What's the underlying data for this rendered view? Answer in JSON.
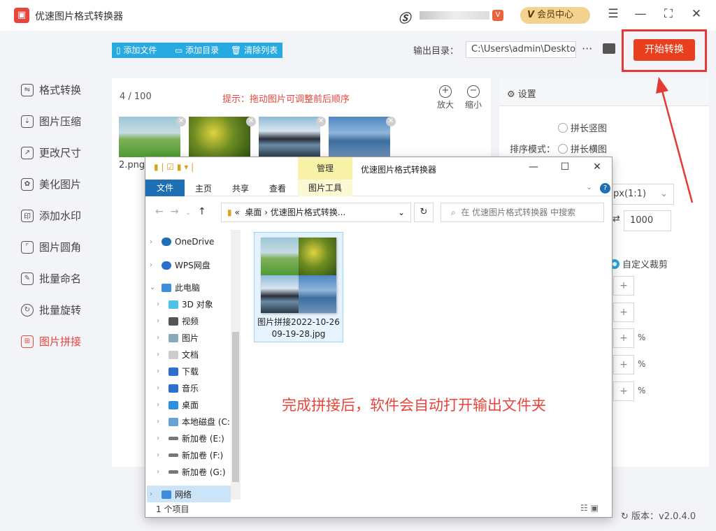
{
  "app": {
    "title": "优速图片格式转换器",
    "vip_label": "会员中心",
    "vip_glyph": "V"
  },
  "sidebar": {
    "items": [
      {
        "label": "格式转换",
        "icon": "format-convert-icon"
      },
      {
        "label": "图片压缩",
        "icon": "compress-icon"
      },
      {
        "label": "更改尺寸",
        "icon": "resize-icon"
      },
      {
        "label": "美化图片",
        "icon": "beautify-icon"
      },
      {
        "label": "添加水印",
        "icon": "watermark-icon"
      },
      {
        "label": "图片圆角",
        "icon": "round-corner-icon"
      },
      {
        "label": "批量命名",
        "icon": "rename-icon"
      },
      {
        "label": "批量旋转",
        "icon": "rotate-icon"
      },
      {
        "label": "图片拼接",
        "icon": "stitch-icon",
        "active": true
      }
    ]
  },
  "toolbar": {
    "add_file": "添加文件",
    "add_dir": "添加目录",
    "clear_list": "清除列表",
    "output_label": "输出目录：",
    "output_path": "C:\\Users\\admin\\Deskto",
    "start": "开始转换"
  },
  "panel": {
    "count": "4 / 100",
    "hint": "提示：拖动图片可调整前后顺序",
    "zoom_in": "放大",
    "zoom_out": "缩小",
    "file_label": "2.png"
  },
  "settings": {
    "title": "设置",
    "sort_label": "排序模式：",
    "vertical": "拼长竖图",
    "horizontal": "拼长横图",
    "ratio": "px(1:1)",
    "width": "1000",
    "crop": "自定义裁剪",
    "pct": "%"
  },
  "explorer": {
    "manage": "管理",
    "title": "优速图片格式转换器",
    "tabs": {
      "file": "文件",
      "home": "主页",
      "share": "共享",
      "view": "查看",
      "pictools": "图片工具"
    },
    "breadcrumb": {
      "root": "«",
      "desktop": "桌面",
      "folder": "优速图片格式转换..."
    },
    "search_placeholder": "在 优速图片格式转换器 中搜索",
    "nav": [
      "OneDrive",
      "WPS网盘",
      "此电脑",
      "3D 对象",
      "视频",
      "图片",
      "文档",
      "下载",
      "音乐",
      "桌面",
      "本地磁盘 (C:",
      "新加卷 (E:)",
      "新加卷 (F:)",
      "新加卷 (G:)",
      "网络"
    ],
    "file_name": "图片拼接2022-10-26 09-19-28.jpg",
    "status": "1 个项目"
  },
  "annotation": "完成拼接后，软件会自动打开输出文件夹",
  "footer": {
    "version": "版本：v2.0.4.0"
  },
  "colors": {
    "accent_red": "#e8453c",
    "accent_blue": "#27a9e1",
    "annotation_frame": "#e53935"
  }
}
